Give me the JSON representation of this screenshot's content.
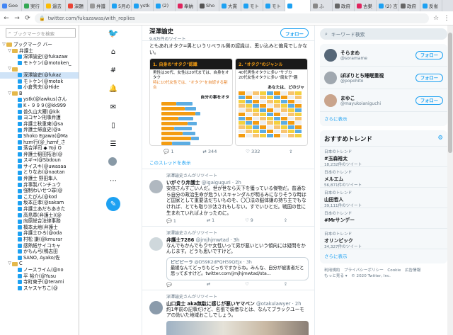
{
  "browser": {
    "tabs": [
      {
        "label": "Goo",
        "fav": "#4285f4"
      },
      {
        "label": "実行",
        "fav": "#34a853"
      },
      {
        "label": "過去",
        "fav": "#fbbc05"
      },
      {
        "label": "演題",
        "fav": "#ea4335"
      },
      {
        "label": "弁護",
        "fav": "#999999"
      },
      {
        "label": "5月の",
        "fav": "#1da1f2"
      },
      {
        "label": "ystk",
        "fav": "#1da1f2"
      },
      {
        "label": "(2)",
        "fav": "#1da1f2"
      },
      {
        "label": "奉納",
        "fav": "#e0245e"
      },
      {
        "label": "Sho",
        "fav": "#555555"
      },
      {
        "label": "大貫",
        "fav": "#1da1f2"
      },
      {
        "label": "モト",
        "fav": "#1da1f2"
      },
      {
        "label": "モト",
        "fav": "#1da1f2"
      },
      {
        "label": "",
        "fav": "#1da1f2",
        "active": true
      },
      {
        "label": "ふ",
        "fav": "#888888"
      },
      {
        "label": "政府",
        "fav": "#666666"
      },
      {
        "label": "古巣",
        "fav": "#e0245e"
      },
      {
        "label": "(2) 言",
        "fav": "#1da1f2"
      },
      {
        "label": "政府",
        "fav": "#666666"
      },
      {
        "label": "反省",
        "fav": "#1da1f2"
      }
    ],
    "url": "twitter.com/fukazawas/with_replies",
    "back_icon": "back-arrow-icon",
    "lock_icon": "lock-icon"
  },
  "sidebar": {
    "search_placeholder": "ブックマークを検索",
    "items": [
      {
        "t": "ブックマーク バー",
        "lv": 0,
        "k": "folder",
        "tg": "▽"
      },
      {
        "t": "弁護士",
        "lv": 1,
        "k": "folder",
        "tg": "▽"
      },
      {
        "t": "深澤諭史(@fukazaw",
        "lv": 2,
        "k": "bm"
      },
      {
        "t": "モトケン(@motoken_",
        "lv": 2,
        "k": "bm"
      },
      {
        "t": "",
        "lv": 1,
        "k": "folder",
        "tg": "▽"
      },
      {
        "t": "深澤諭史(@fukaz",
        "lv": 2,
        "k": "bm",
        "sel": true
      },
      {
        "t": "モトケン(@motok",
        "lv": 2,
        "k": "bm"
      },
      {
        "t": "小倉秀夫(@Hide",
        "lv": 2,
        "k": "bm"
      },
      {
        "t": "B",
        "lv": 1,
        "k": "folder",
        "tg": "▽"
      },
      {
        "t": "ystk(@lawkus)さん",
        "lv": 2,
        "k": "bm"
      },
      {
        "t": "K・９９９(@kk999",
        "lv": 2,
        "k": "bm"
      },
      {
        "t": "普久山大爾(@kik",
        "lv": 2,
        "k": "bm"
      },
      {
        "t": "ヨコヤン刑事弁護",
        "lv": 2,
        "k": "bm"
      },
      {
        "t": "弁護士秋重東(@sa",
        "lv": 2,
        "k": "bm"
      },
      {
        "t": "弁護士帰直史(@a",
        "lv": 2,
        "k": "bm"
      },
      {
        "t": "Shoko Egawa(@Ma",
        "lv": 2,
        "k": "bm"
      },
      {
        "t": "hzm行(@_hzmf_さ",
        "lv": 2,
        "k": "bm"
      },
      {
        "t": "落合洋司 ◆ Yoji O",
        "lv": 2,
        "k": "bm"
      },
      {
        "t": "弁護士稲田拓治(@",
        "lv": 2,
        "k": "bm"
      },
      {
        "t": "スギ→(@Sbdoun",
        "lv": 2,
        "k": "bm"
      },
      {
        "t": "サイスキ(@uwasaa",
        "lv": 2,
        "k": "bm"
      },
      {
        "t": "とりなお(@naotan",
        "lv": 2,
        "k": "bm"
      },
      {
        "t": "弁護士 野田隼人",
        "lv": 2,
        "k": "bm"
      },
      {
        "t": "弁事製パンチュウ",
        "lv": 2,
        "k": "bm"
      },
      {
        "t": "強制わいせつ罪(@",
        "lv": 2,
        "k": "bm"
      },
      {
        "t": "こたぴん(@kod",
        "lv": 2,
        "k": "bm"
      },
      {
        "t": "坂本正孝(@sakam",
        "lv": 2,
        "k": "bm"
      },
      {
        "t": "弁護士あだちあきた",
        "lv": 2,
        "k": "bm"
      },
      {
        "t": "高島章(弁護士)(@",
        "lv": 2,
        "k": "bm"
      },
      {
        "t": "向原総合法律事務",
        "lv": 2,
        "k": "bm"
      },
      {
        "t": "橋本太地(弁護士",
        "lv": 2,
        "k": "bm"
      },
      {
        "t": "弁護士ひろ(@oda",
        "lv": 2,
        "k": "bm"
      },
      {
        "t": "村松 謙(@kmurar",
        "lv": 2,
        "k": "bm"
      },
      {
        "t": "感熱紙サイコキャ",
        "lv": 2,
        "k": "bm"
      },
      {
        "t": "かもん弓(鴨志田",
        "lv": 2,
        "k": "bm"
      },
      {
        "t": "SANO, Ayako/佐",
        "lv": 2,
        "k": "bm"
      },
      {
        "t": "C",
        "lv": 1,
        "k": "folder",
        "tg": "▽"
      },
      {
        "t": "ノースライム(@no",
        "lv": 2,
        "k": "bm"
      },
      {
        "t": "平 裕介(@Yusu",
        "lv": 2,
        "k": "bm"
      },
      {
        "t": "寺町東子(@terami",
        "lv": 2,
        "k": "bm"
      },
      {
        "t": "スヤスヤちこ(@",
        "lv": 2,
        "k": "bm"
      }
    ]
  },
  "main": {
    "name": "深澤諭史",
    "count": "9.6万件のツイート",
    "follow": "フォロー",
    "top_text": "ともあれオタク=男というリベラル側の認識は、思い込みと偏見でしかない。",
    "img1_title": "1. 自身の\"オタク\"認識",
    "img1_b1": "男性は30代、女性は20代までは、自身をオタク",
    "img1_b2": "特に10代女性では、\"オタク\"を自認する割合",
    "img1_sub": "自分の事をオタ",
    "img2_title": "2. \"オタク\"のジャンル",
    "img2_b1": "40代男性オタクに多い\"サブカ",
    "img2_b2": "20代女性オタクに多い\"腐女子\"趣",
    "img2_sub": "あなたは、どのジャ",
    "tweet0_stats": {
      "reply": "1",
      "rt": "344",
      "like": "332"
    },
    "thread": "このスレッドを表示",
    "tweets": [
      {
        "rt": "深澤諭史さんがリツイート",
        "name": "いがぐり弁護士",
        "handle": "@igaiguguri · 2h",
        "text": "安倍さんすごい人だ。世が世なら天下を獲っている傑物だ。普通なら自分の政治生命が危ういスキャンダルが明るみになりそうな時ほど国家として重要法だちいものを、〇〇法の脳体嫌の持ち主でもなければ、とても取り沙汰されもしない。すでいひとだ。戦国の世に生まれていればよかったのに。",
        "r": "1",
        "t": "1",
        "l": "9",
        "av": "#b0b8c0"
      },
      {
        "rt": "深澤諭史さんがリツイート",
        "name": "弁護士7286",
        "handle": "@jmjhjmwtad · 3h",
        "text": "なんでもかんでもウヤ女性いって男が悪いという傾向には疑問をかんじます。どうも思いですけど。",
        "q_name": "ピピピーラ",
        "q_handle": "@D59K2dPQH59QEJx · 3h",
        "q_text": "最緩なんてどっちもどっちですからね。みんな、自分が被害者だと思ってますけど。twitter.com/jmjhjmwtad/sta...",
        "r": "",
        "t": "",
        "l": "",
        "av": "#cfd8dc"
      },
      {
        "rt": "深澤諭史さんがリツイート",
        "name": "山口貴士 aka無駄に感じが悪いヤマベン",
        "handle": "@otakulawyer · 2h",
        "text": "約1年前の記事だけど、名張で装者なとは、なんてブラックユーモアの効いた地域おこしでしょう。",
        "av": "#8b9bab"
      }
    ]
  },
  "right": {
    "search": "キーワード検索",
    "users": [
      {
        "name": "そらまめ",
        "handle": "@soramame",
        "btn": "フォロー",
        "av": "#556677"
      },
      {
        "name": "ぽぽりとち睡眠重視",
        "handle": "@popohito",
        "btn": "フォロー",
        "av": "#a0a8b0"
      },
      {
        "name": "まゆこ",
        "handle": "@mayukoianiguchi",
        "btn": "フォロー",
        "av": "#c9a48c"
      }
    ],
    "more": "さらに表示",
    "trend_title": "おすすめトレンド",
    "trends": [
      {
        "loc": "日本のトレンド",
        "name": "#玉森裕太",
        "count": "18,232件のツイート"
      },
      {
        "loc": "日本のトレンド",
        "name": "メルエム",
        "count": "56,871件のツイート"
      },
      {
        "loc": "日本のトレンド",
        "name": "山田哲人",
        "count": "39,111件のツイート"
      },
      {
        "loc": "日本のトレンド",
        "name": "#Mrサンデー",
        "count": ""
      },
      {
        "loc": "日本のトレンド",
        "name": "オリンピック",
        "count": "34,327件のツイート"
      }
    ],
    "trend_more": "さらに表示",
    "footer1": "利用規約　プライバシーポリシー　Cookie　広告情報",
    "footer2": "もっと見る ▾　© 2020 Twitter, Inc."
  },
  "colors": {
    "accent": "#1da1f2",
    "orange": "#f39c12",
    "yellow": "#f4d03f",
    "blue_bar": "#5dade2"
  }
}
